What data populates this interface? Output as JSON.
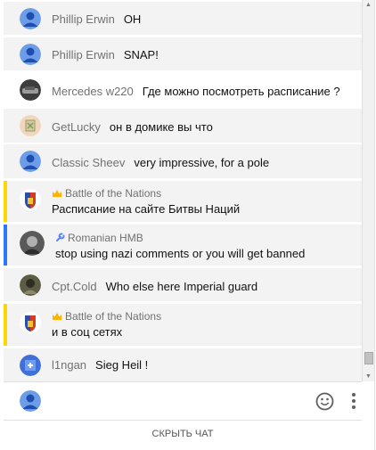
{
  "messages": [
    {
      "author": "Phillip Erwin",
      "text": "OH"
    },
    {
      "author": "Phillip Erwin",
      "text": "SNAP!"
    },
    {
      "author": "Mercedes w220",
      "text": "Где можно посмотреть расписание ?"
    },
    {
      "author": "GetLucky",
      "text": "он в домике вы что"
    },
    {
      "author": "Classic Sheev",
      "text": "very impressive, for a pole"
    },
    {
      "author": "Battle of the Nations",
      "badge": "crown-icon",
      "text": "Расписание на сайте Битвы Наций"
    },
    {
      "author": "Romanian HMB",
      "badge": "wrench-icon",
      "text": "stop using nazi comments or you will get banned"
    },
    {
      "author": "Cpt.Cold",
      "text": "Who else here Imperial guard"
    },
    {
      "author": "Battle of the Nations",
      "badge": "crown-icon",
      "text": "и в соц сетях"
    },
    {
      "author": "l1ngan",
      "text": "Sieg Heil !"
    }
  ],
  "footer": {
    "hide_chat_label": "СКРЫТЬ ЧАТ"
  },
  "colors": {
    "owner_highlight": "#ffd600",
    "moderator_highlight": "#2979ff",
    "owner_badge": "#ffb300",
    "moderator_badge": "#5e84f1"
  }
}
